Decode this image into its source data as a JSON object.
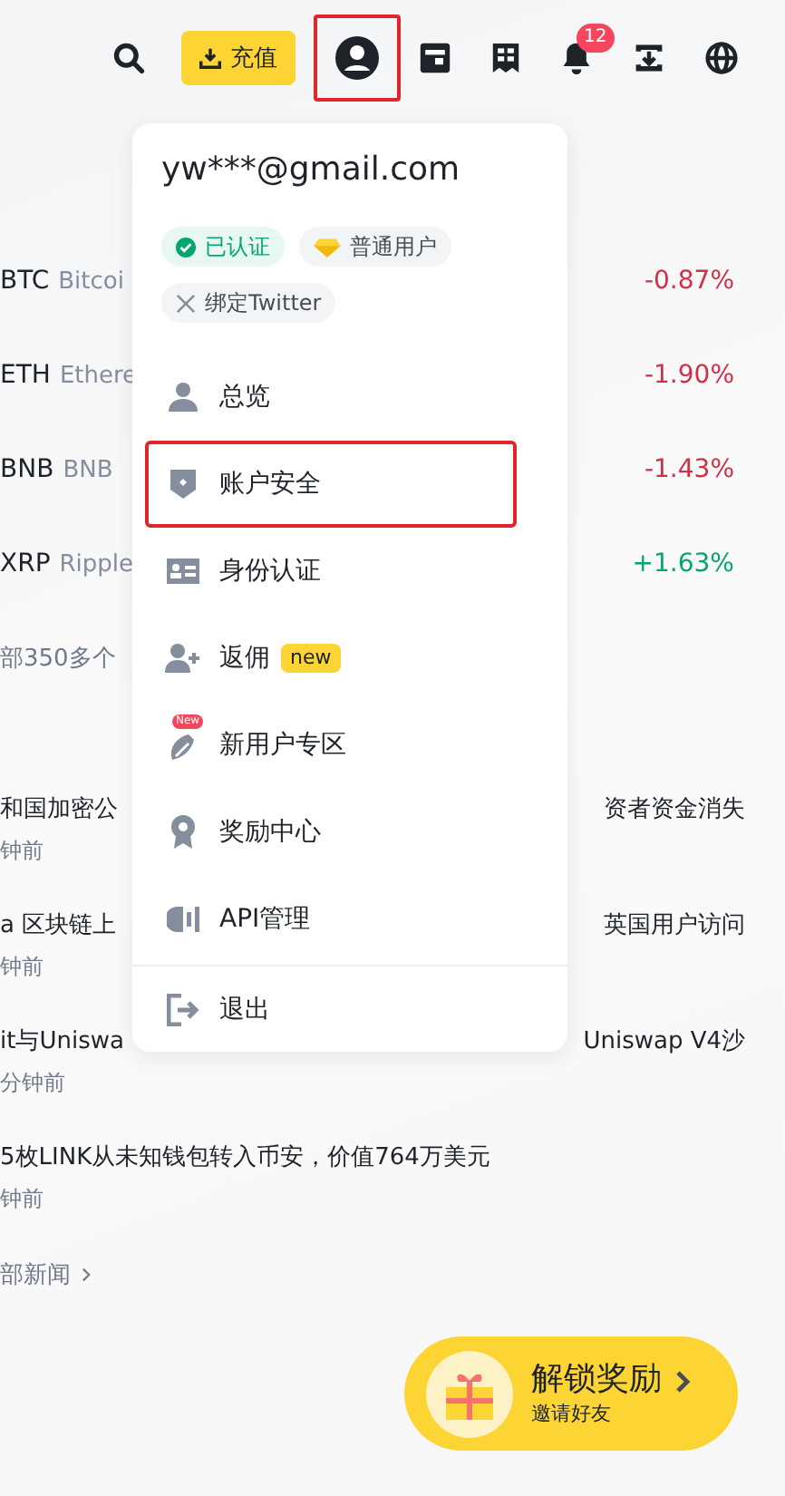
{
  "topbar": {
    "deposit_label": "充值",
    "notification_count": "12",
    "account_highlighted": true
  },
  "markets": [
    {
      "symbol": "BTC",
      "name": "Bitcoi",
      "change": "-0.87%",
      "color": "#cf304a"
    },
    {
      "symbol": "ETH",
      "name": "Ethere",
      "change": "-1.90%",
      "color": "#cf304a"
    },
    {
      "symbol": "BNB",
      "name": "BNB",
      "change": "-1.43%",
      "color": "#cf304a"
    },
    {
      "symbol": "XRP",
      "name": "Ripple",
      "change": "+1.63%",
      "color": "#03a66d"
    }
  ],
  "markets_more": "部350多个",
  "news": [
    {
      "title_left": "和国加密公",
      "title_right": "资者资金消失",
      "time": "钟前"
    },
    {
      "title_left": "a 区块链上",
      "title_right": "英国用户访问",
      "time": "钟前"
    },
    {
      "title_left": "it与Uniswa",
      "title_right": "Uniswap V4沙",
      "time": "分钟前"
    },
    {
      "title_left": "5枚LINK从未知钱包转入币安，价值764万美元",
      "time": "钟前"
    }
  ],
  "news_more": "部新闻",
  "menu": {
    "email": "yw***@gmail.com",
    "badges": [
      {
        "kind": "verified",
        "label": "已认证"
      },
      {
        "kind": "tier",
        "label": "普通用户"
      },
      {
        "kind": "twitter",
        "label": "绑定Twitter"
      }
    ],
    "items": [
      {
        "kind": "overview",
        "label": "总览",
        "highlighted": false
      },
      {
        "kind": "security",
        "label": "账户安全",
        "highlighted": true
      },
      {
        "kind": "identity",
        "label": "身份认证",
        "highlighted": false
      },
      {
        "kind": "referral",
        "label": "返佣",
        "tag": "new",
        "highlighted": false
      },
      {
        "kind": "newuser",
        "label": "新用户专区",
        "icon_tag": "New",
        "highlighted": false
      },
      {
        "kind": "rewards",
        "label": "奖励中心",
        "highlighted": false
      },
      {
        "kind": "api",
        "label": "API管理",
        "highlighted": false
      }
    ],
    "logout": "退出"
  },
  "reward": {
    "title": "解锁奖励",
    "subtitle": "邀请好友"
  }
}
